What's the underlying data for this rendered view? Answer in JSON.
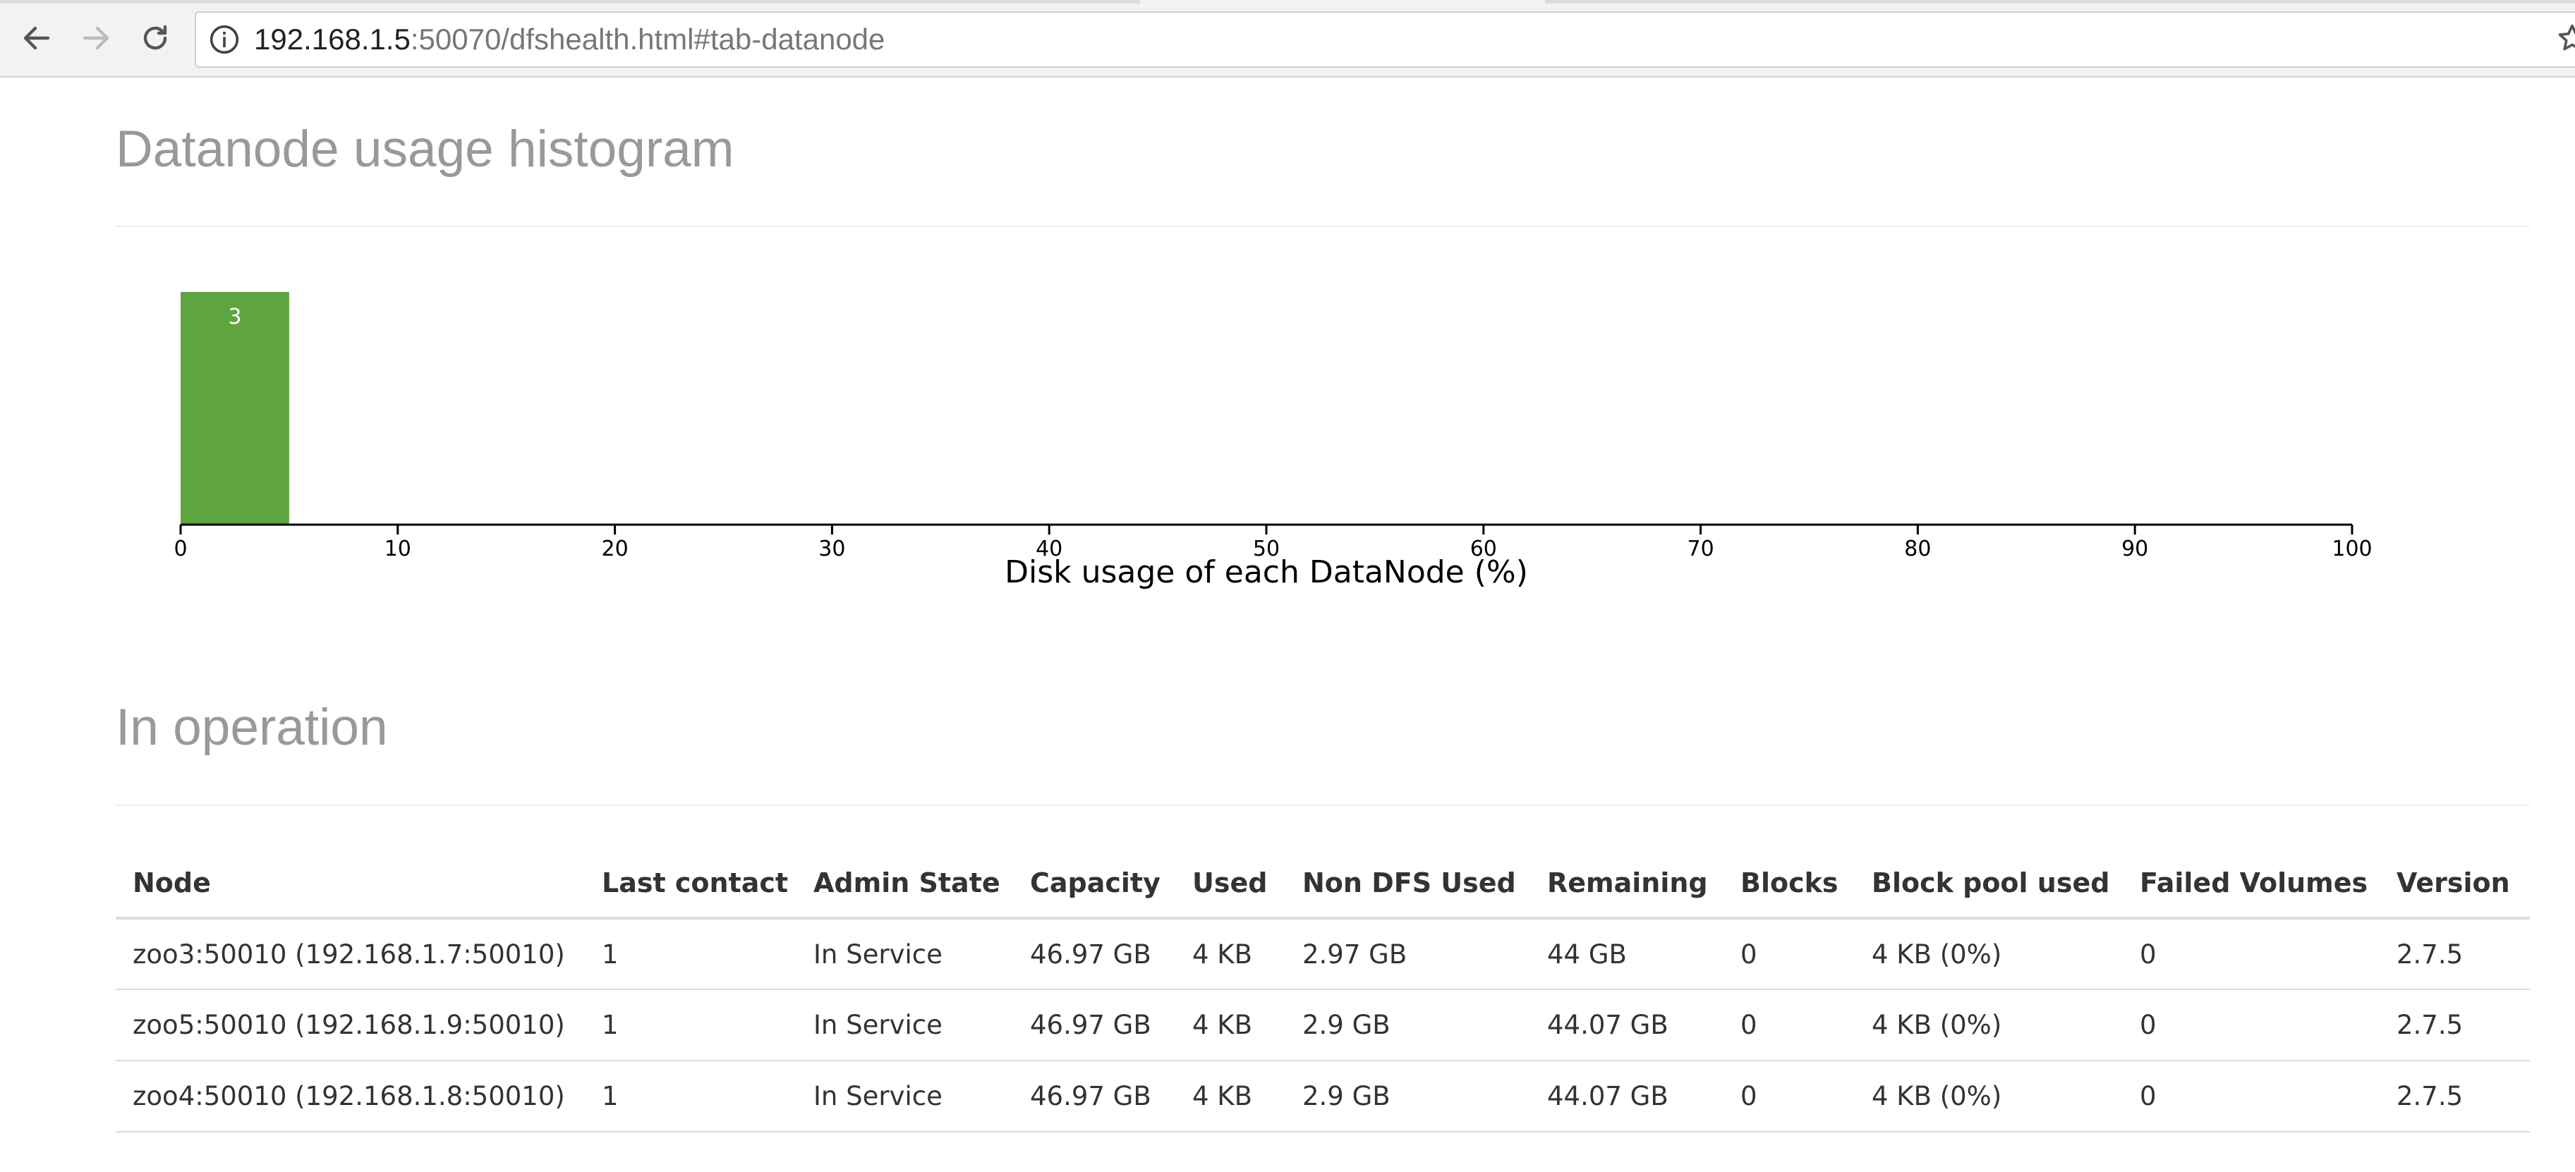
{
  "browser": {
    "url_host": "192.168.1.5",
    "url_rest": ":50070/dfshealth.html#tab-datanode",
    "icons": [
      "back-arrow-icon",
      "forward-arrow-icon",
      "reload-icon",
      "info-icon",
      "star-icon"
    ]
  },
  "histogram": {
    "title": "Datanode usage histogram"
  },
  "chart_data": {
    "type": "bar",
    "bins": [
      [
        0,
        5
      ]
    ],
    "values": [
      3
    ],
    "bar_labels": [
      "3"
    ],
    "x_ticks": [
      0,
      10,
      20,
      30,
      40,
      50,
      60,
      70,
      80,
      90,
      100
    ],
    "xlim": [
      0,
      100
    ],
    "xlabel": "Disk usage of each DataNode (%)",
    "ylabel": "",
    "bar_color": "#5ea540",
    "grid": false
  },
  "operation": {
    "title": "In operation",
    "columns": [
      "Node",
      "Last contact",
      "Admin State",
      "Capacity",
      "Used",
      "Non DFS Used",
      "Remaining",
      "Blocks",
      "Block pool used",
      "Failed Volumes",
      "Version"
    ],
    "rows": [
      [
        "zoo3:50010 (192.168.1.7:50010)",
        "1",
        "In Service",
        "46.97 GB",
        "4 KB",
        "2.97 GB",
        "44 GB",
        "0",
        "4 KB (0%)",
        "0",
        "2.7.5"
      ],
      [
        "zoo5:50010 (192.168.1.9:50010)",
        "1",
        "In Service",
        "46.97 GB",
        "4 KB",
        "2.9 GB",
        "44.07 GB",
        "0",
        "4 KB (0%)",
        "0",
        "2.7.5"
      ],
      [
        "zoo4:50010 (192.168.1.8:50010)",
        "1",
        "In Service",
        "46.97 GB",
        "4 KB",
        "2.9 GB",
        "44.07 GB",
        "0",
        "4 KB (0%)",
        "0",
        "2.7.5"
      ]
    ]
  }
}
